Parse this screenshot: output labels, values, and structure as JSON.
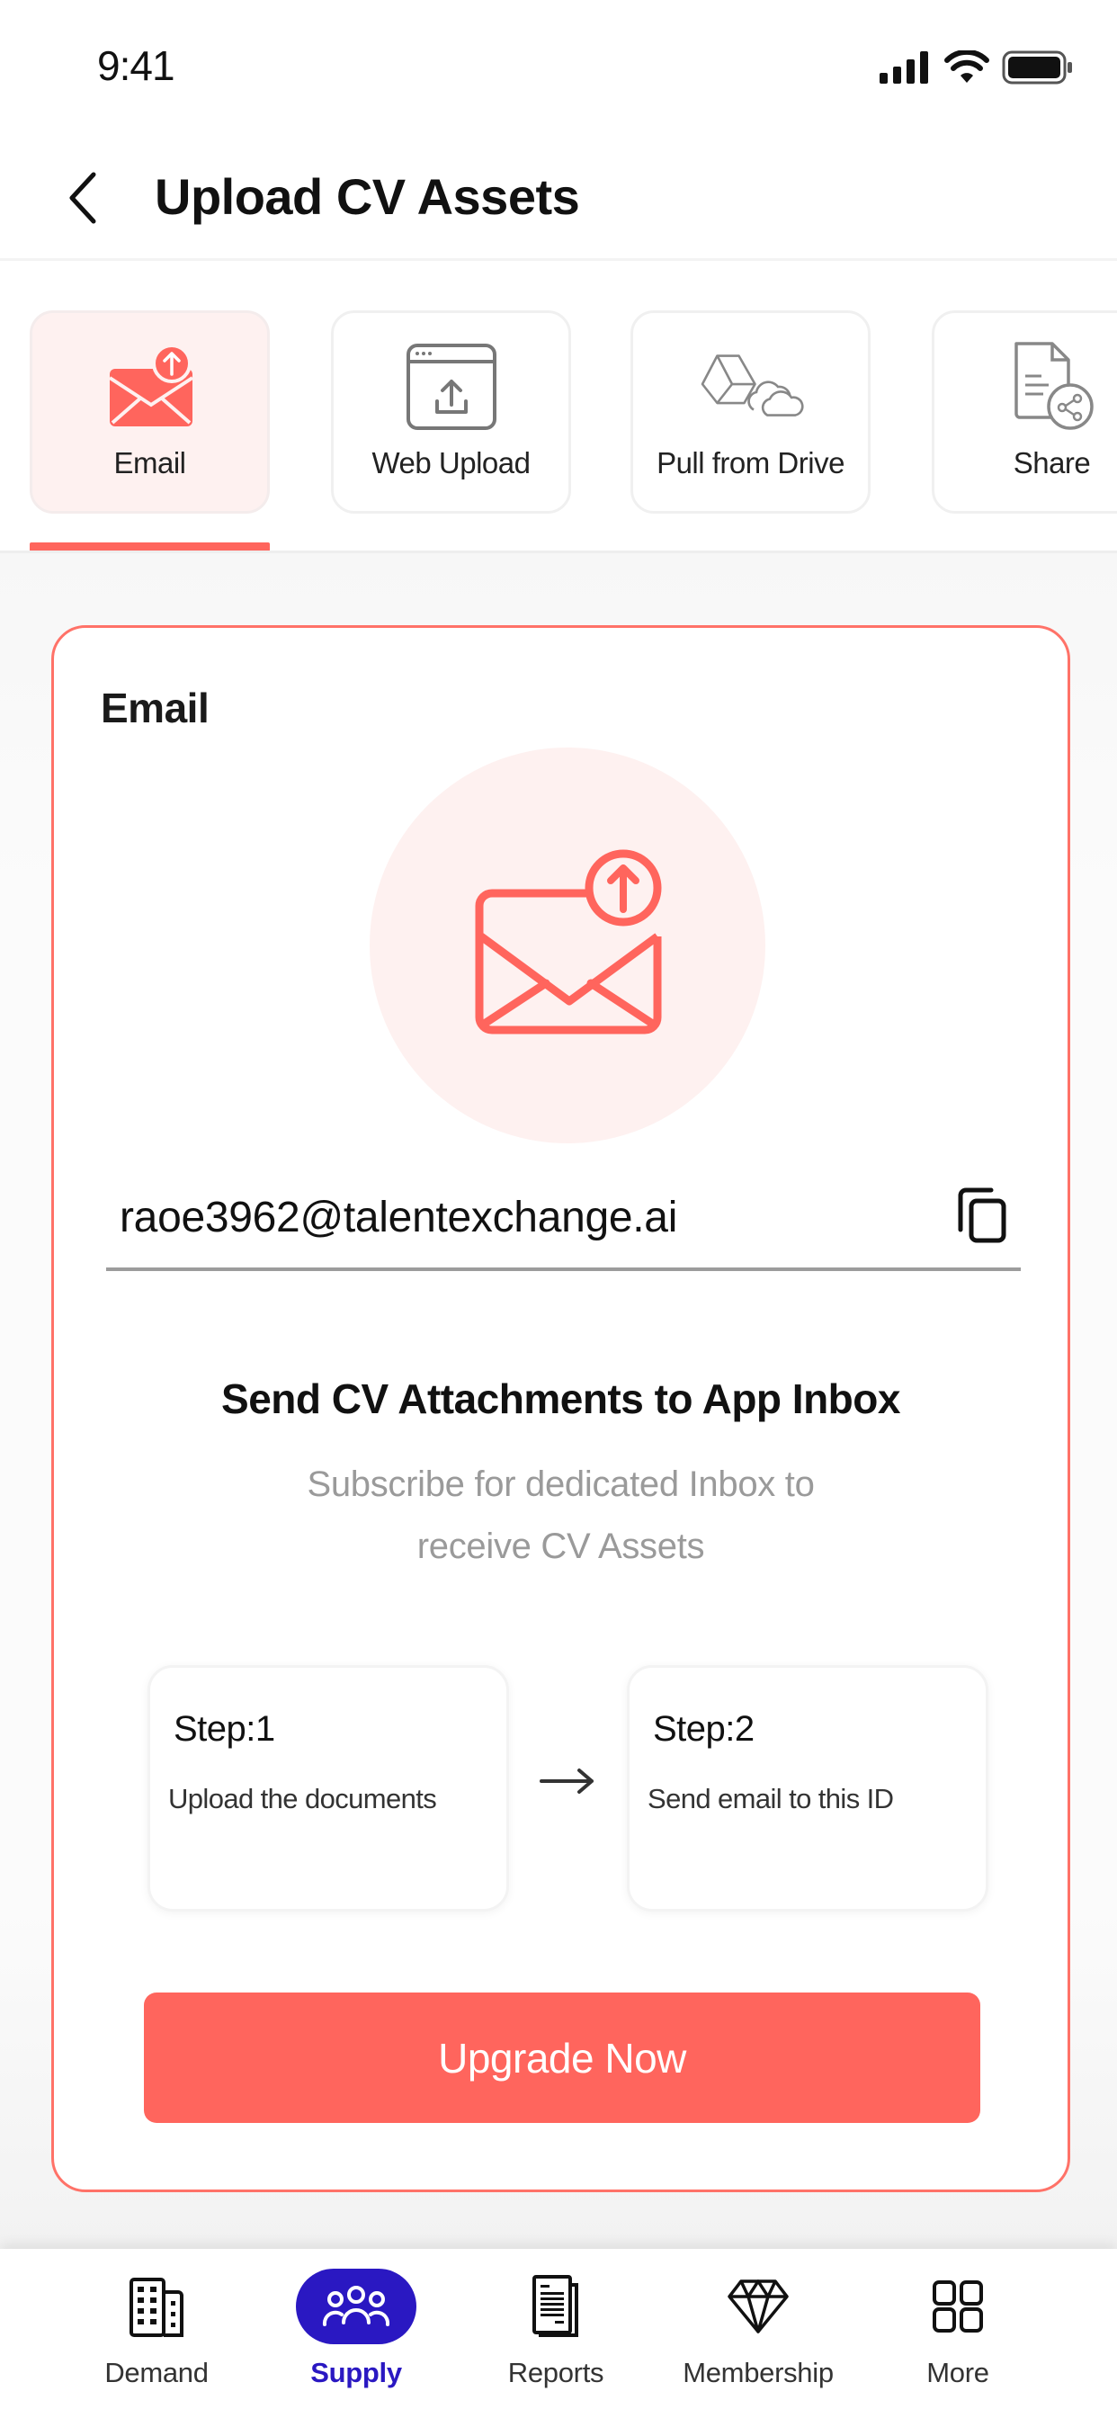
{
  "status_bar": {
    "time": "9:41",
    "icons": [
      "cellular-signal-icon",
      "wifi-icon",
      "battery-icon"
    ]
  },
  "header": {
    "back_icon": "chevron-left-icon",
    "title": "Upload CV Assets"
  },
  "tabs": [
    {
      "label": "Email",
      "icon": "email-upload-icon",
      "active": true
    },
    {
      "label": "Web Upload",
      "icon": "browser-upload-icon",
      "active": false
    },
    {
      "label": "Pull from Drive",
      "icon": "drive-cloud-icon",
      "active": false
    },
    {
      "label": "Share",
      "icon": "document-share-icon",
      "active": false
    }
  ],
  "email_card": {
    "title": "Email",
    "hero_icon": "email-upload-icon",
    "email_address": "raoe3962@talentexchange.ai",
    "copy_icon": "copy-icon",
    "heading": "Send CV Attachments to App Inbox",
    "subtitle_lines": [
      "Subscribe for dedicated Inbox to",
      "receive CV Assets"
    ],
    "steps": [
      {
        "title": "Step:1",
        "description": "Upload the documents"
      },
      {
        "title": "Step:2",
        "description": "Send email to this ID"
      }
    ],
    "arrow": "arrow-right-icon",
    "cta_label": "Upgrade Now"
  },
  "bottom_nav": [
    {
      "label": "Demand",
      "icon": "building-icon",
      "active": false
    },
    {
      "label": "Supply",
      "icon": "people-group-icon",
      "active": true
    },
    {
      "label": "Reports",
      "icon": "report-document-icon",
      "active": false
    },
    {
      "label": "Membership",
      "icon": "diamond-icon",
      "active": false
    },
    {
      "label": "More",
      "icon": "grid-icon",
      "active": false
    }
  ],
  "colors": {
    "accent": "#FF655D",
    "accent_tint": "#FEF1F0",
    "nav_active": "#2A18C2",
    "muted_text": "#9A9A9A"
  }
}
